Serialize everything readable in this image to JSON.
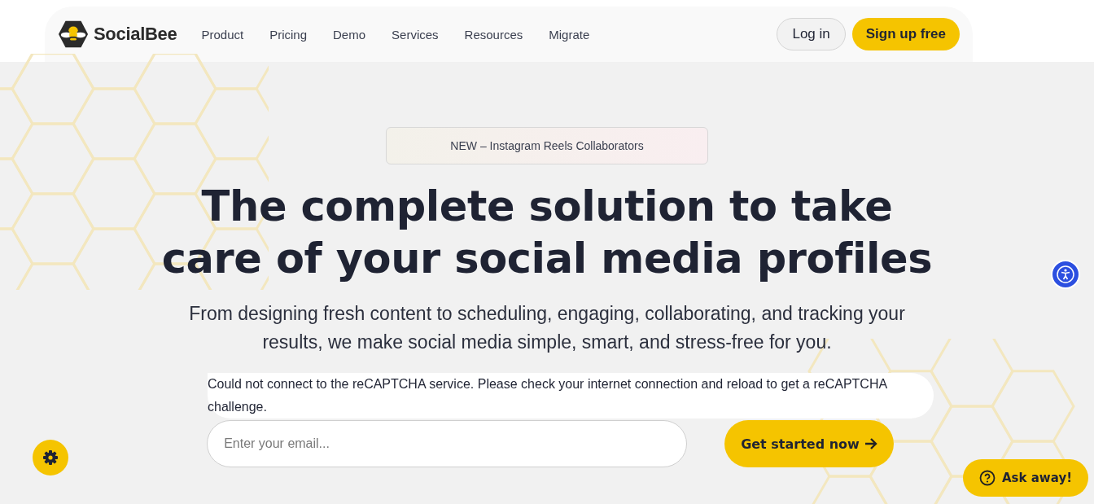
{
  "header": {
    "brand": "SocialBee",
    "nav": [
      "Product",
      "Pricing",
      "Demo",
      "Services",
      "Resources",
      "Migrate"
    ],
    "login": "Log in",
    "signup": "Sign up free"
  },
  "hero": {
    "announcement": "NEW – Instagram Reels Collaborators",
    "title_lines": [
      "The complete solution to take",
      "care of your social media profiles"
    ],
    "subtitle_lines": [
      "From designing fresh content to scheduling, engaging, collaborating, and tracking your",
      "results, we make social media simple, smart, and stress-free for you."
    ],
    "recaptcha_error": "Could not connect to the reCAPTCHA service. Please check your internet connection and reload to get a reCAPTCHA challenge.",
    "email": {
      "placeholder": "Enter your email..."
    },
    "cta": "Get started now"
  },
  "chat": {
    "label": "Ask away!"
  }
}
